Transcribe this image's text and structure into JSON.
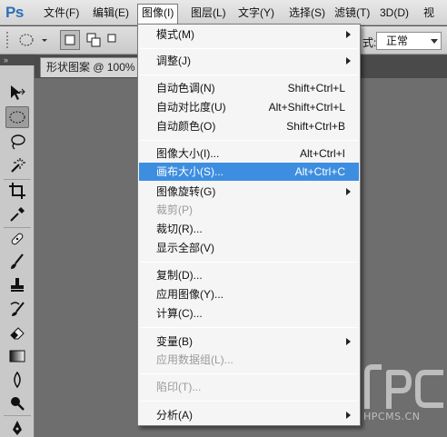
{
  "app": {
    "logo_text": "Ps"
  },
  "menubar": {
    "items": [
      {
        "label": "文件(F)"
      },
      {
        "label": "编辑(E)"
      },
      {
        "label": "图像(I)"
      },
      {
        "label": "图层(L)"
      },
      {
        "label": "文字(Y)"
      },
      {
        "label": "选择(S)"
      },
      {
        "label": "滤镜(T)"
      },
      {
        "label": "3D(D)"
      },
      {
        "label": "视"
      }
    ]
  },
  "options": {
    "style_label": "式:",
    "style_value": "正常"
  },
  "document": {
    "tab_title": "形状图案 @ 100%"
  },
  "toolbox": {
    "grip_label": "»"
  },
  "image_menu": {
    "items": [
      {
        "label": "模式(M)",
        "shortcut": "",
        "submenu": true
      },
      {
        "label": "调整(J)",
        "shortcut": "",
        "submenu": true
      },
      {
        "label": "自动色调(N)",
        "shortcut": "Shift+Ctrl+L"
      },
      {
        "label": "自动对比度(U)",
        "shortcut": "Alt+Shift+Ctrl+L"
      },
      {
        "label": "自动颜色(O)",
        "shortcut": "Shift+Ctrl+B"
      },
      {
        "label": "图像大小(I)...",
        "shortcut": "Alt+Ctrl+I"
      },
      {
        "label": "画布大小(S)...",
        "shortcut": "Alt+Ctrl+C",
        "highlighted": true
      },
      {
        "label": "图像旋转(G)",
        "shortcut": "",
        "submenu": true
      },
      {
        "label": "裁剪(P)",
        "shortcut": "",
        "disabled": true
      },
      {
        "label": "裁切(R)...",
        "shortcut": ""
      },
      {
        "label": "显示全部(V)",
        "shortcut": ""
      },
      {
        "label": "复制(D)...",
        "shortcut": ""
      },
      {
        "label": "应用图像(Y)...",
        "shortcut": ""
      },
      {
        "label": "计算(C)...",
        "shortcut": ""
      },
      {
        "label": "变量(B)",
        "shortcut": "",
        "submenu": true
      },
      {
        "label": "应用数据组(L)...",
        "shortcut": "",
        "disabled": true
      },
      {
        "label": "陷印(T)...",
        "shortcut": "",
        "disabled": true
      },
      {
        "label": "分析(A)",
        "shortcut": "",
        "submenu": true
      }
    ]
  },
  "watermark": {
    "text": "HPCMS.CN"
  },
  "colors": {
    "highlight": "#3d8ee0",
    "logo": "#2f6fb4"
  }
}
